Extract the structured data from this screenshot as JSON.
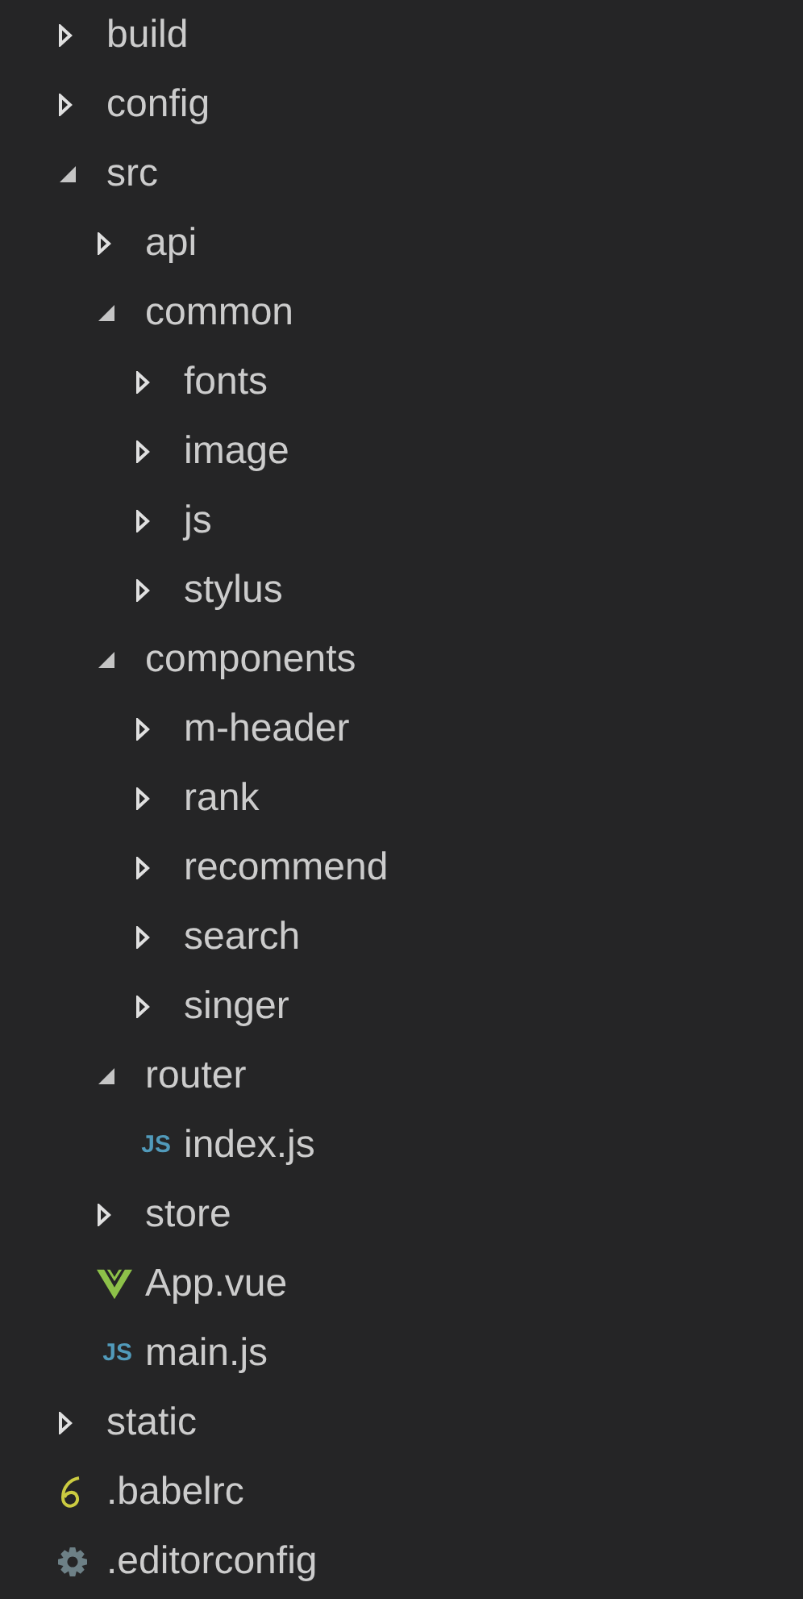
{
  "explorer": {
    "tree": [
      {
        "kind": "folder",
        "label": "build",
        "expanded": false
      },
      {
        "kind": "folder",
        "label": "config",
        "expanded": false
      },
      {
        "kind": "folder",
        "label": "src",
        "expanded": true,
        "children": [
          {
            "kind": "folder",
            "label": "api",
            "expanded": false
          },
          {
            "kind": "folder",
            "label": "common",
            "expanded": true,
            "children": [
              {
                "kind": "folder",
                "label": "fonts",
                "expanded": false
              },
              {
                "kind": "folder",
                "label": "image",
                "expanded": false
              },
              {
                "kind": "folder",
                "label": "js",
                "expanded": false
              },
              {
                "kind": "folder",
                "label": "stylus",
                "expanded": false
              }
            ]
          },
          {
            "kind": "folder",
            "label": "components",
            "expanded": true,
            "children": [
              {
                "kind": "folder",
                "label": "m-header",
                "expanded": false
              },
              {
                "kind": "folder",
                "label": "rank",
                "expanded": false
              },
              {
                "kind": "folder",
                "label": "recommend",
                "expanded": false
              },
              {
                "kind": "folder",
                "label": "search",
                "expanded": false
              },
              {
                "kind": "folder",
                "label": "singer",
                "expanded": false
              }
            ]
          },
          {
            "kind": "folder",
            "label": "router",
            "expanded": true,
            "children": [
              {
                "kind": "js",
                "icon_text": "JS",
                "label": "index.js"
              }
            ]
          },
          {
            "kind": "folder",
            "label": "store",
            "expanded": false
          },
          {
            "kind": "vue",
            "label": "App.vue"
          },
          {
            "kind": "js",
            "icon_text": "JS",
            "label": "main.js"
          }
        ]
      },
      {
        "kind": "folder",
        "label": "static",
        "expanded": false
      },
      {
        "kind": "babel",
        "label": ".babelrc"
      },
      {
        "kind": "config",
        "label": ".editorconfig"
      }
    ]
  }
}
